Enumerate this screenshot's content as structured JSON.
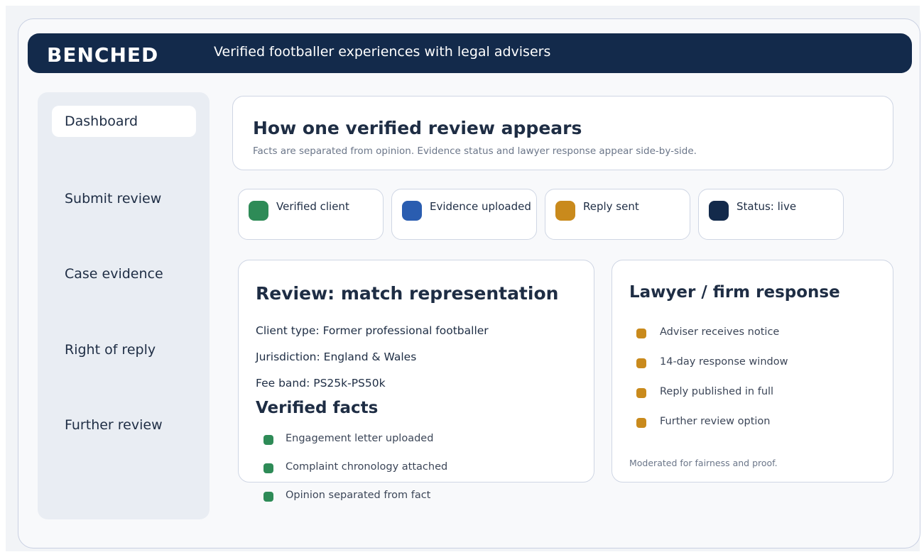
{
  "header": {
    "brand": "BENCHED",
    "tagline": "Verified footballer experiences with legal advisers"
  },
  "sidebar": {
    "items": [
      {
        "label": "Dashboard",
        "active": true
      },
      {
        "label": "Submit review",
        "active": false
      },
      {
        "label": "Case evidence",
        "active": false
      },
      {
        "label": "Right of reply",
        "active": false
      },
      {
        "label": "Further review",
        "active": false
      }
    ]
  },
  "intro": {
    "title": "How one verified review appears",
    "subtitle": "Facts are separated from opinion. Evidence status and lawyer response appear side-by-side."
  },
  "badges": [
    {
      "label": "Verified client",
      "color": "#2e8b57"
    },
    {
      "label": "Evidence uploaded",
      "color": "#2a5db0"
    },
    {
      "label": "Reply sent",
      "color": "#c98a1c"
    },
    {
      "label": "Status: live",
      "color": "#132a4b"
    }
  ],
  "review": {
    "title": "Review: match representation",
    "client_type": "Client type: Former professional footballer",
    "jurisdiction": "Jurisdiction: England & Wales",
    "fee_band": "Fee band: PS25k-PS50k",
    "facts_title": "Verified facts",
    "facts": [
      "Engagement letter uploaded",
      "Complaint chronology attached",
      "Opinion separated from fact"
    ]
  },
  "response": {
    "title": "Lawyer / firm response",
    "steps": [
      "Adviser receives notice",
      "14-day response window",
      "Reply published in full",
      "Further review option"
    ],
    "note": "Moderated for fairness and proof."
  },
  "colors": {
    "navy": "#132a4b",
    "green": "#2e8b57",
    "blue": "#2a5db0",
    "amber": "#c98a1c"
  }
}
